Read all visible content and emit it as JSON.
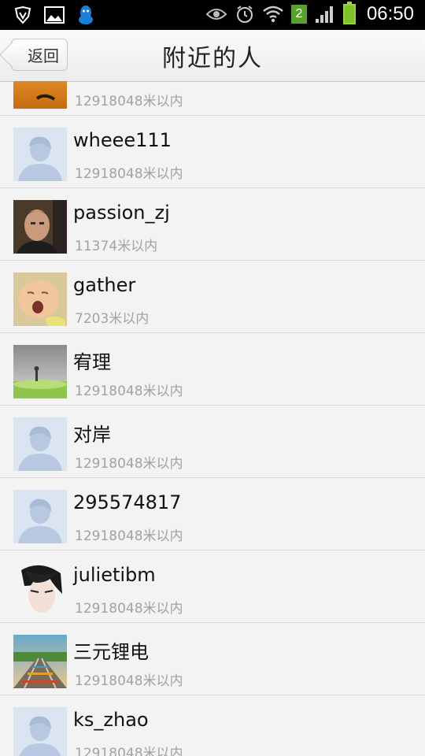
{
  "status_bar": {
    "time": "06:50",
    "sim_badge": "2",
    "icons_left": [
      "shield-icon",
      "image-icon",
      "qq-icon"
    ],
    "icons_right": [
      "eye-icon",
      "alarm-icon",
      "wifi-icon",
      "sim-badge",
      "signal-icon",
      "battery-icon"
    ]
  },
  "header": {
    "back_label": "返回",
    "title": "附近的人"
  },
  "list": {
    "items": [
      {
        "name": "",
        "distance": "12918048米以内",
        "avatar": "orange-photo"
      },
      {
        "name": "wheee111",
        "distance": "12918048米以内",
        "avatar": "default"
      },
      {
        "name": "passion_zj",
        "distance": "11374米以内",
        "avatar": "man-photo"
      },
      {
        "name": "gather",
        "distance": "7203米以内",
        "avatar": "baby-photo"
      },
      {
        "name": "宥理",
        "distance": "12918048米以内",
        "avatar": "field-photo"
      },
      {
        "name": "对岸",
        "distance": "12918048米以内",
        "avatar": "default"
      },
      {
        "name": "295574817",
        "distance": "12918048米以内",
        "avatar": "default"
      },
      {
        "name": "julietibm",
        "distance": "12918048米以内",
        "avatar": "anime-photo"
      },
      {
        "name": "三元锂电",
        "distance": "12918048米以内",
        "avatar": "rail-photo"
      },
      {
        "name": "ks_zhao",
        "distance": "12918048米以内",
        "avatar": "default"
      }
    ]
  },
  "colors": {
    "status_bg": "#000000",
    "list_bg": "#f3f3f3",
    "distance_text": "#a2a2a2",
    "default_avatar": "#dbe5f2"
  }
}
